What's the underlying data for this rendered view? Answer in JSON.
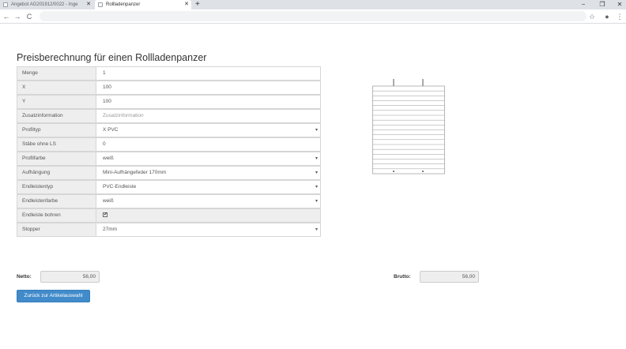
{
  "browser": {
    "tabs": [
      {
        "title": "Angebot AG201912/0022 - Inge",
        "active": false
      },
      {
        "title": "Rollladenpanzer",
        "active": true
      }
    ],
    "new_tab_icon": "plus-icon",
    "window_controls": [
      "−",
      "❐",
      "✕"
    ],
    "nav": {
      "back": "←",
      "forward": "→",
      "reload": "C"
    },
    "toolbar_icons": {
      "star": "☆",
      "profile": "●",
      "menu": "⋮"
    },
    "url": ""
  },
  "page": {
    "title": "Preisberechnung für einen Rollladenpanzer",
    "form": {
      "rows": [
        {
          "label": "Menge",
          "value": "1",
          "type": "input"
        },
        {
          "label": "X",
          "value": "100",
          "type": "input"
        },
        {
          "label": "Y",
          "value": "100",
          "type": "input"
        },
        {
          "label": "Zusatzinformation",
          "value": "",
          "placeholder": "Zusatzinformation",
          "type": "input"
        },
        {
          "label": "Profiltyp",
          "value": "X PVC",
          "type": "select"
        },
        {
          "label": "Stäbe ohne LS",
          "value": "0",
          "type": "input"
        },
        {
          "label": "Profilfarbe",
          "value": "weiß",
          "type": "select"
        },
        {
          "label": "Aufhängung",
          "value": "Mini-Aufhängefeder 170mm",
          "type": "select"
        },
        {
          "label": "Endleistentyp",
          "value": "PVC-Endleiste",
          "type": "select"
        },
        {
          "label": "Endleistenfarbe",
          "value": "weiß",
          "type": "select"
        },
        {
          "label": "Endleiste bohren",
          "value": "✔",
          "type": "checkbox"
        },
        {
          "label": "Stopper",
          "value": "27mm",
          "type": "select"
        }
      ]
    },
    "netto": {
      "label": "Netto:",
      "value": "56,00"
    },
    "brutto": {
      "label": "Brutto:",
      "value": "56,00"
    },
    "back_button": "Zurück zur Artikelauswahl"
  }
}
